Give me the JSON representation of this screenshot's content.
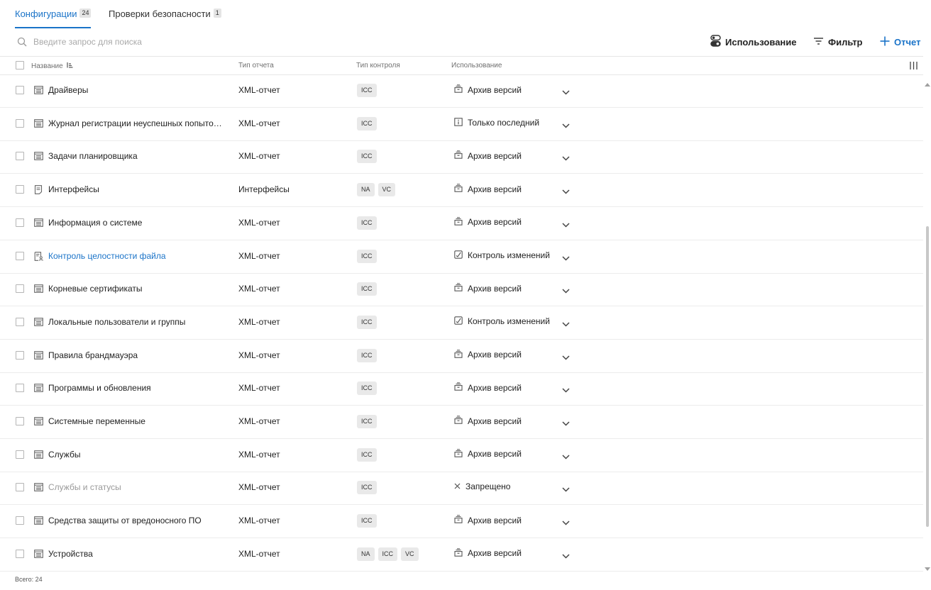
{
  "tabs": [
    {
      "label": "Конфигурации",
      "count": "24",
      "active": true
    },
    {
      "label": "Проверки безопасности",
      "count": "1",
      "active": false
    }
  ],
  "search": {
    "placeholder": "Введите запрос для поиска",
    "value": ""
  },
  "toolbar": {
    "usage_label": "Использование",
    "filter_label": "Фильтр",
    "report_label": "Отчет"
  },
  "columns": {
    "name": "Название",
    "report_type": "Тип отчета",
    "control_type": "Тип контроля",
    "usage": "Использование"
  },
  "rows": [
    {
      "name": "Драйверы",
      "icon": "report-icon",
      "report_type": "XML-отчет",
      "tags": [
        "ICC"
      ],
      "usage": "Архив версий",
      "usage_icon": "archive-icon"
    },
    {
      "name": "Журнал регистрации неуспешных попыток входа",
      "icon": "report-icon",
      "report_type": "XML-отчет",
      "tags": [
        "ICC"
      ],
      "usage": "Только последний",
      "usage_icon": "info-icon"
    },
    {
      "name": "Задачи планировщика",
      "icon": "report-icon",
      "report_type": "XML-отчет",
      "tags": [
        "ICC"
      ],
      "usage": "Архив версий",
      "usage_icon": "archive-icon"
    },
    {
      "name": "Интерфейсы",
      "icon": "document-icon",
      "report_type": "Интерфейсы",
      "tags": [
        "NA",
        "VC"
      ],
      "usage": "Архив версий",
      "usage_icon": "archive-icon"
    },
    {
      "name": "Информация о системе",
      "icon": "report-icon",
      "report_type": "XML-отчет",
      "tags": [
        "ICC"
      ],
      "usage": "Архив версий",
      "usage_icon": "archive-icon"
    },
    {
      "name": "Контроль целостности файла",
      "icon": "file-user-icon",
      "report_type": "XML-отчет",
      "tags": [
        "ICC"
      ],
      "usage": "Контроль изменений",
      "usage_icon": "change-control-icon",
      "style": "link"
    },
    {
      "name": "Корневые сертификаты",
      "icon": "report-icon",
      "report_type": "XML-отчет",
      "tags": [
        "ICC"
      ],
      "usage": "Архив версий",
      "usage_icon": "archive-icon"
    },
    {
      "name": "Локальные пользователи и группы",
      "icon": "report-icon",
      "report_type": "XML-отчет",
      "tags": [
        "ICC"
      ],
      "usage": "Контроль изменений",
      "usage_icon": "change-control-icon"
    },
    {
      "name": "Правила брандмауэра",
      "icon": "report-icon",
      "report_type": "XML-отчет",
      "tags": [
        "ICC"
      ],
      "usage": "Архив версий",
      "usage_icon": "archive-icon"
    },
    {
      "name": "Программы и обновления",
      "icon": "report-icon",
      "report_type": "XML-отчет",
      "tags": [
        "ICC"
      ],
      "usage": "Архив версий",
      "usage_icon": "archive-icon"
    },
    {
      "name": "Системные переменные",
      "icon": "report-icon",
      "report_type": "XML-отчет",
      "tags": [
        "ICC"
      ],
      "usage": "Архив версий",
      "usage_icon": "archive-icon"
    },
    {
      "name": "Службы",
      "icon": "report-icon",
      "report_type": "XML-отчет",
      "tags": [
        "ICC"
      ],
      "usage": "Архив версий",
      "usage_icon": "archive-icon"
    },
    {
      "name": "Службы и статусы",
      "icon": "report-icon",
      "report_type": "XML-отчет",
      "tags": [
        "ICC"
      ],
      "usage": "Запрещено",
      "usage_icon": "forbidden-icon",
      "style": "muted"
    },
    {
      "name": "Средства защиты от вредоносного ПО",
      "icon": "report-icon",
      "report_type": "XML-отчет",
      "tags": [
        "ICC"
      ],
      "usage": "Архив версий",
      "usage_icon": "archive-icon"
    },
    {
      "name": "Устройства",
      "icon": "report-icon",
      "report_type": "XML-отчет",
      "tags": [
        "NA",
        "ICC",
        "VC"
      ],
      "usage": "Архив версий",
      "usage_icon": "archive-icon"
    }
  ],
  "footer": {
    "total_label": "Всего: 24"
  },
  "colors": {
    "accent": "#1a73c8",
    "muted_text": "#9a9a9a",
    "tag_bg": "#e9e9e9"
  }
}
